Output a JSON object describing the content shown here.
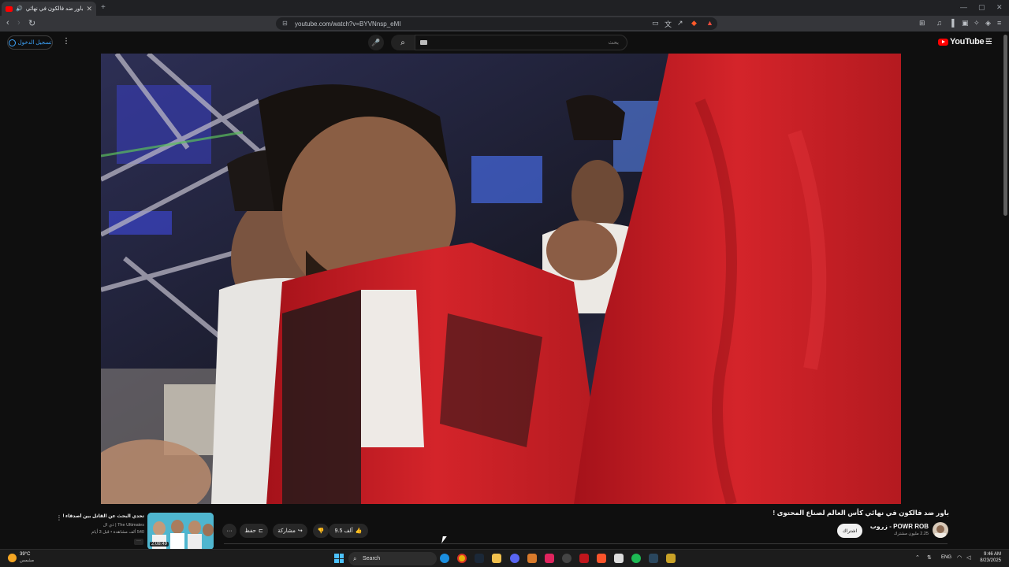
{
  "browser": {
    "tab_title": "باور ضد فالكون في نهائي كأس",
    "tab_close": "✕",
    "new_tab": "+",
    "url": "youtube.com/watch?v=BYVNnsp_eMI",
    "window_controls": [
      "—",
      "▢",
      "✕"
    ]
  },
  "yt": {
    "sign_in": "تسجيل الدخول",
    "search_placeholder": "بحث",
    "logo_text": "YouTube",
    "logo_region": "SA"
  },
  "video": {
    "title": "باور ضد فالكون في نهائي كأس العالم لصناع المحتوى !",
    "channel": "POWR ROB - زروب",
    "subscribers": "2.25 مليون مشترك",
    "subscribe_label": "اشتراك",
    "likes": "9.5 ألف",
    "share_label": "مشاركة",
    "save_label": "حفظ",
    "more_label": "···"
  },
  "recommendation": {
    "title": "تحدي البحث عن القاتل بين أصدقاء TU 🔥",
    "channel": "The Ultimates | ذي ال",
    "meta": "540 ألف مشاهدة • قبل 3 أيام",
    "duration": "2:08:49",
    "more": "···"
  },
  "taskbar": {
    "weather_temp": "39°C",
    "weather_desc": "مشمس",
    "search_label": "Search",
    "lang": "ENG",
    "time": "9:46 AM",
    "date": "8/23/2025"
  },
  "colors": {
    "yt_red": "#ff0000",
    "link_blue": "#3ea6ff",
    "flag_red": "#c41a1e"
  }
}
